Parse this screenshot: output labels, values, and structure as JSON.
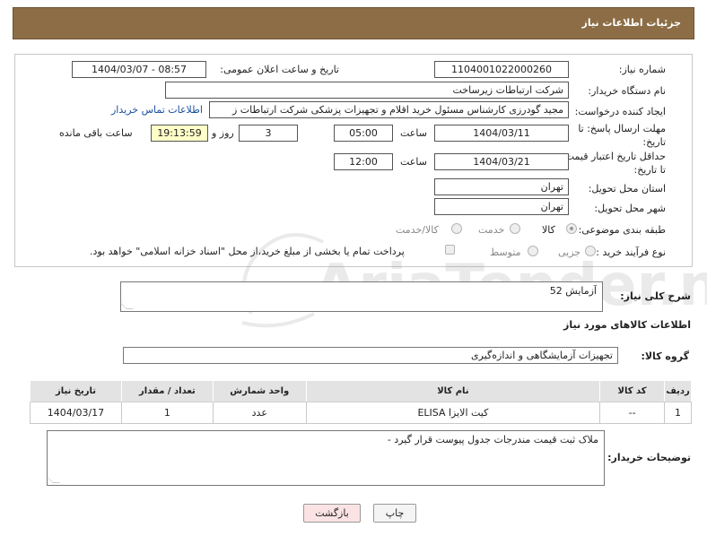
{
  "header": {
    "title": "جزئیات اطلاعات نیاز"
  },
  "form": {
    "need_number_label": "شماره نیاز:",
    "need_number": "1104001022000260",
    "announce_label": "تاریخ و ساعت اعلان عمومی:",
    "announce_value": "1404/03/07 - 08:57",
    "buyer_org_label": "نام دستگاه خریدار:",
    "buyer_org": "شرکت ارتباطات زیرساخت",
    "creator_label": "ایجاد کننده درخواست:",
    "creator": "مجید گودرزی کارشناس مسئول خرید اقلام و تجهیزات پزشکی شرکت ارتباطات ز",
    "contact_link": "اطلاعات تماس خریدار",
    "reply_deadline_label": "مهلت ارسال پاسخ: تا تاریخ:",
    "reply_date": "1404/03/11",
    "time_label": "ساعت",
    "reply_time": "05:00",
    "days_count": "3",
    "days_label": "روز و",
    "remaining_time": "19:13:59",
    "remaining_label": "ساعت باقی مانده",
    "price_validity_label": "حداقل تاریخ اعتبار قیمت: تا تاریخ:",
    "price_date": "1404/03/21",
    "price_time": "12:00",
    "province_label": "استان محل تحویل:",
    "province": "تهران",
    "city_label": "شهر محل تحویل:",
    "city": "تهران",
    "category_label": "طبقه بندی موضوعی:",
    "category_options": [
      "کالا",
      "خدمت",
      "کالا/خدمت"
    ],
    "process_label": "نوع فرآیند خرید :",
    "process_options": [
      "جزیی",
      "متوسط"
    ],
    "payment_note": "پرداخت تمام یا بخشی از مبلغ خرید،از محل \"اسناد خزانه اسلامی\" خواهد بود."
  },
  "description": {
    "label": "شرح کلی نیاز:",
    "value": "آزمایش 52"
  },
  "goods_section": {
    "title": "اطلاعات کالاهای مورد نیاز",
    "group_label": "گروه کالا:",
    "group_value": "تجهیزات آزمایشگاهی و اندازه‌گیری",
    "columns": [
      "ردیف",
      "کد کالا",
      "نام کالا",
      "واحد شمارش",
      "تعداد / مقدار",
      "تاریخ نیاز"
    ],
    "rows": [
      [
        "1",
        "--",
        "کیت الایزا ELISA",
        "عدد",
        "1",
        "1404/03/17"
      ]
    ]
  },
  "buyer_notes": {
    "label": "توضیحات خریدار:",
    "value": "ملاک ثبت قیمت مندرجات جدول پیوست قرار گیرد -"
  },
  "buttons": {
    "print": "چاپ",
    "back": "بازگشت"
  },
  "watermark": {
    "text": "AriaTender.net"
  },
  "colors": {
    "header": "#8c6d45",
    "back_button": "#fbe3e3",
    "yellow_field": "#ffffc8"
  }
}
